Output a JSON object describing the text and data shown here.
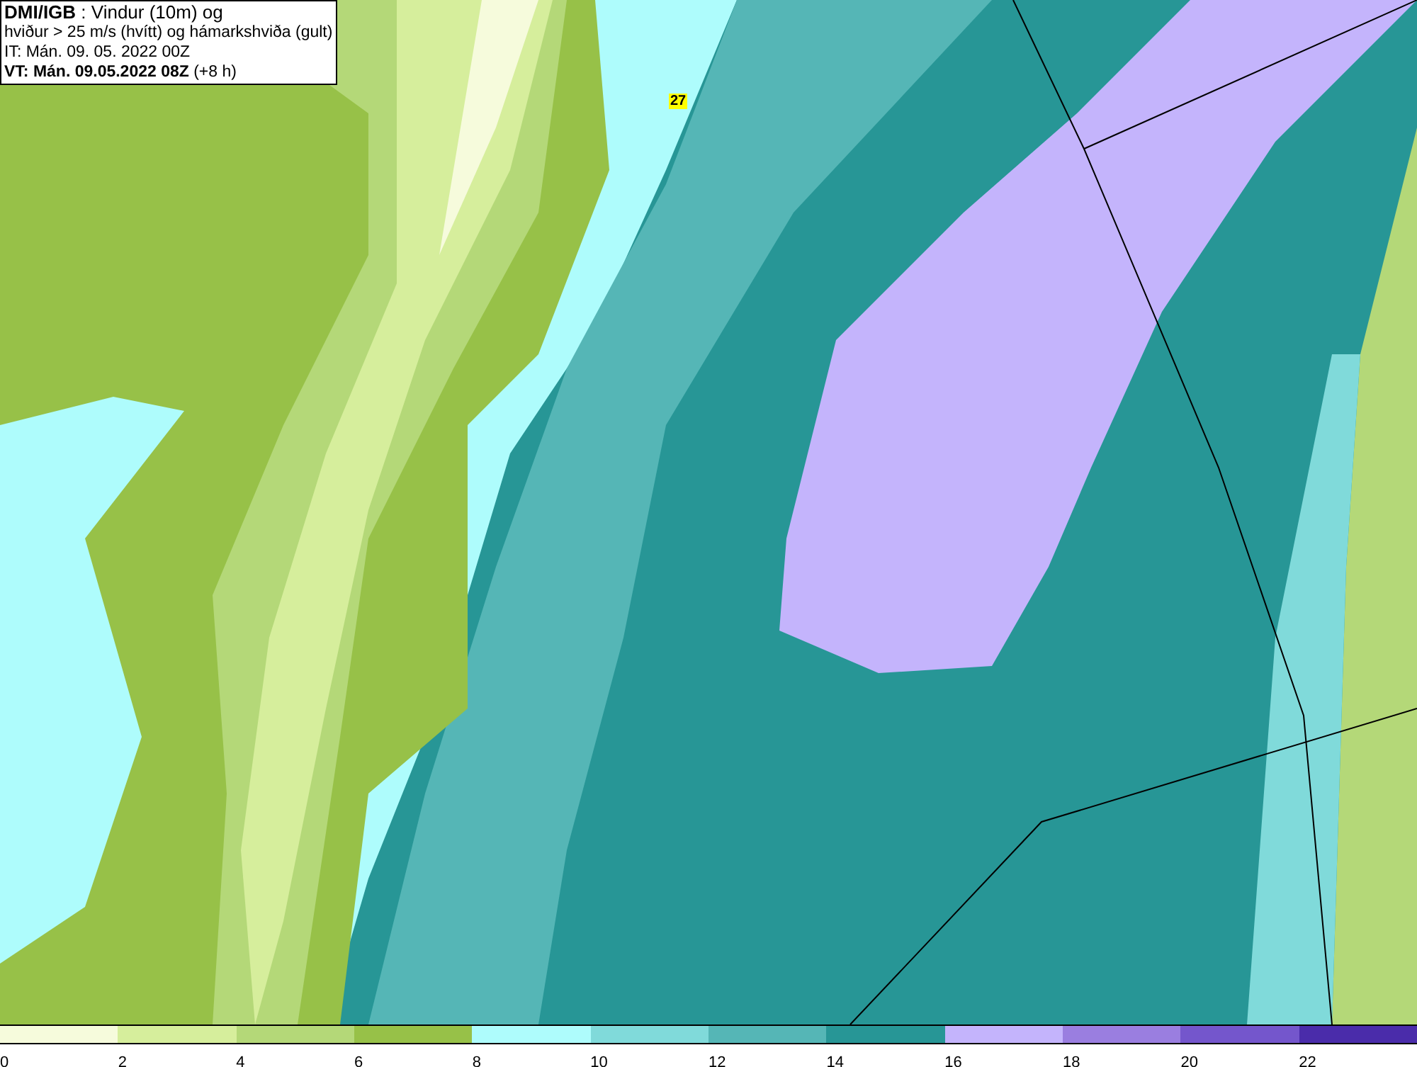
{
  "info_box": {
    "lines": [
      "**DMI/IGB** : Vindur (10m) og",
      "hviður > 25 m/s (hvítt) og hámarkshviða (gult)",
      "IT: Mán. 09. 05. 2022 00Z",
      "**VT: Mán. 09.05.2022 08Z** (+8 h)"
    ]
  },
  "map": {
    "gust_label": "27"
  },
  "legend": {
    "bins": [
      {
        "color": "#f6fbdc",
        "label": "0"
      },
      {
        "color": "#d6ee9c",
        "label": "2"
      },
      {
        "color": "#b4d878",
        "label": "4"
      },
      {
        "color": "#97c148",
        "label": "6"
      },
      {
        "color": "#aefcfc",
        "label": "8"
      },
      {
        "color": "#80dada",
        "label": "10"
      },
      {
        "color": "#55b6b6",
        "label": "12"
      },
      {
        "color": "#279696",
        "label": "14"
      },
      {
        "color": "#c4b4fc",
        "label": "16"
      },
      {
        "color": "#9a7ee0",
        "label": "18"
      },
      {
        "color": "#7456cc",
        "label": "20"
      },
      {
        "color": "#4a2caa",
        "label": "22"
      }
    ]
  }
}
